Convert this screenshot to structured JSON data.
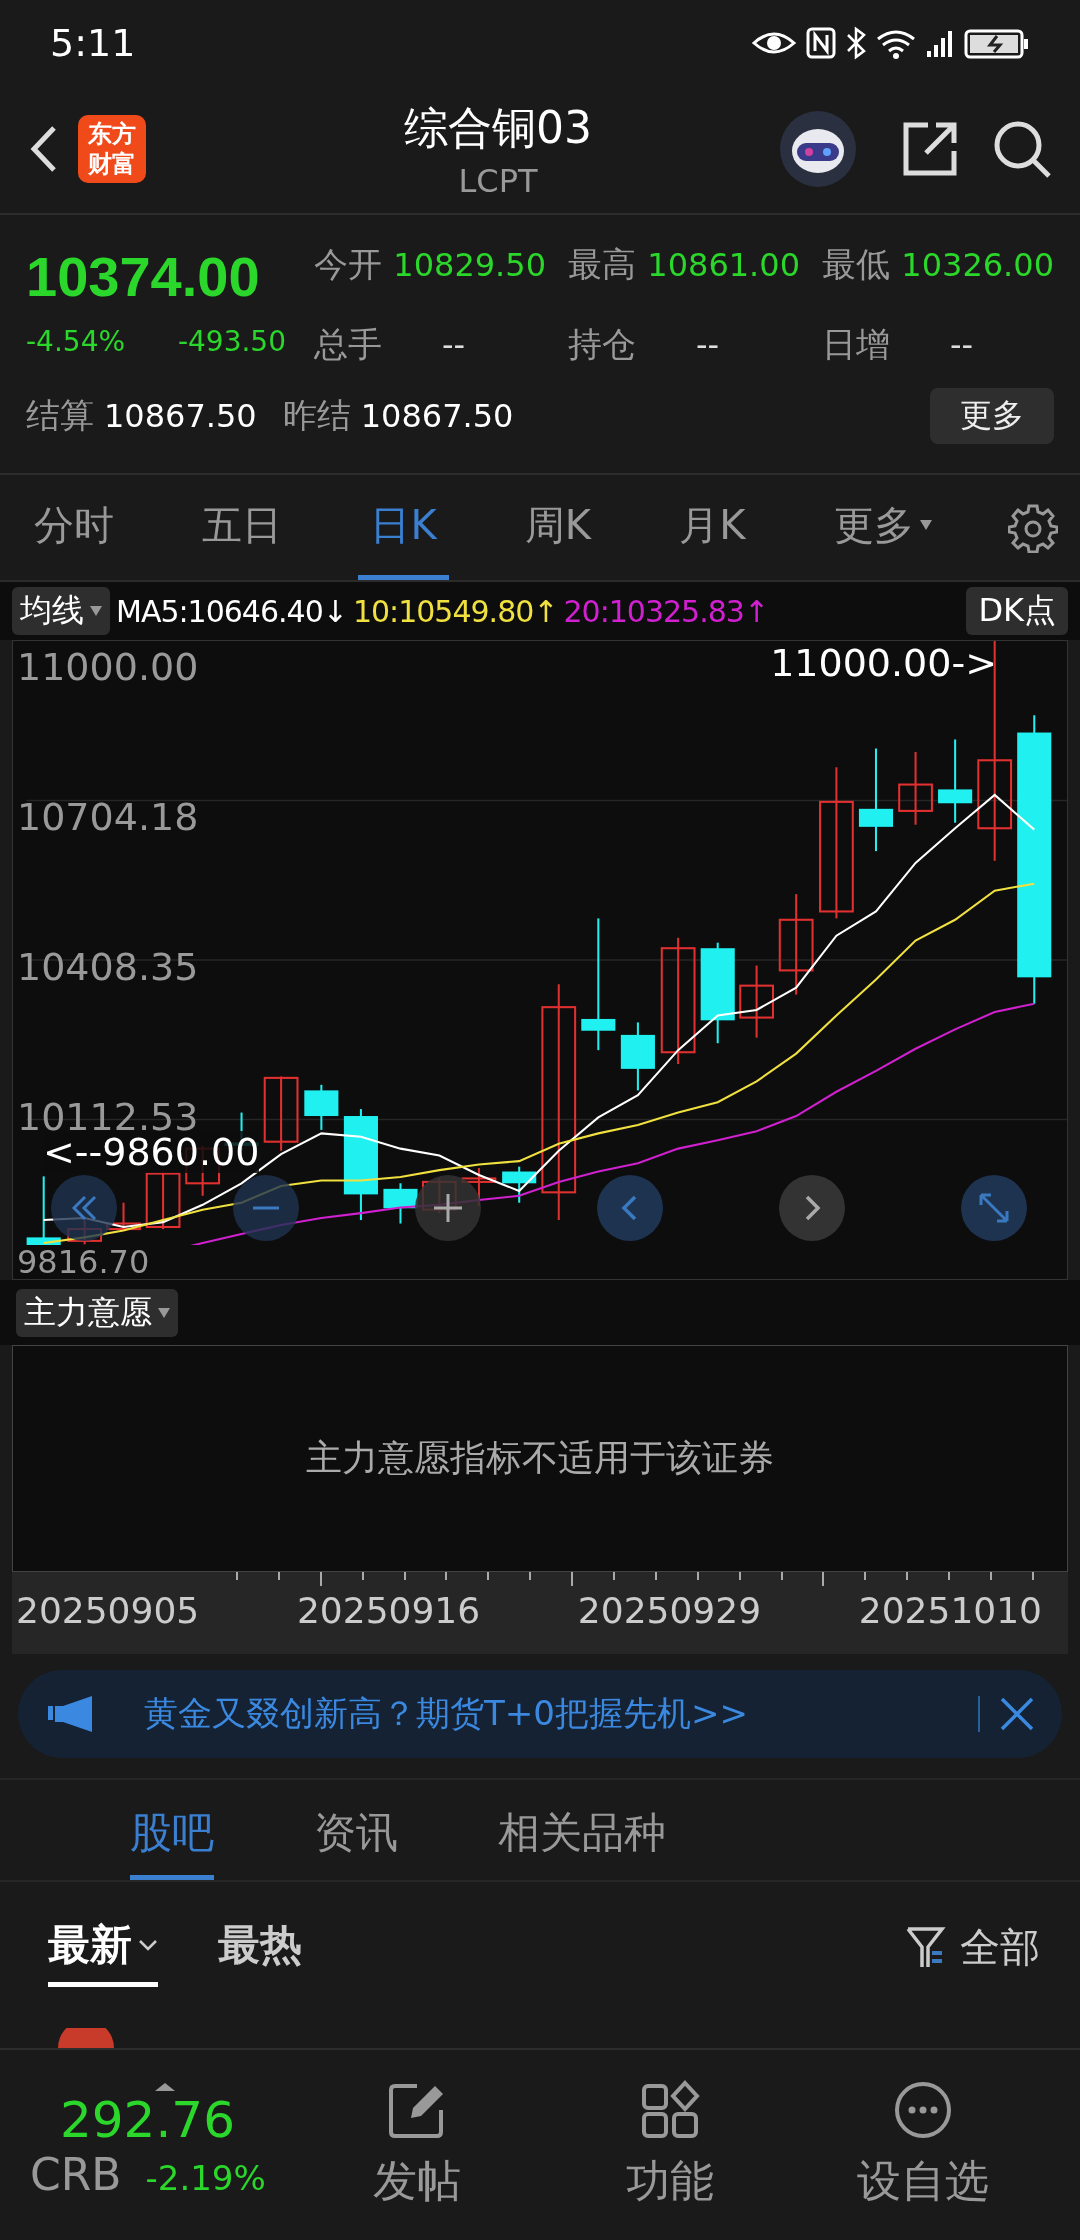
{
  "status_bar": {
    "time": "5:11"
  },
  "header": {
    "title": "综合铜03",
    "subtitle": "LCPT",
    "logo": "东方财富"
  },
  "quote": {
    "price": "10374.00",
    "change_pct": "-4.54%",
    "change": "-493.50",
    "fields": [
      {
        "label": "今开",
        "value": "10829.50",
        "kind": "down"
      },
      {
        "label": "最高",
        "value": "10861.00",
        "kind": "down"
      },
      {
        "label": "最低",
        "value": "10326.00",
        "kind": "down"
      },
      {
        "label": "总手",
        "value": "--",
        "kind": "plain"
      },
      {
        "label": "持仓",
        "value": "--",
        "kind": "plain"
      },
      {
        "label": "日增",
        "value": "--",
        "kind": "plain"
      }
    ],
    "settle": [
      {
        "label": "结算",
        "value": "10867.50"
      },
      {
        "label": "昨结",
        "value": "10867.50"
      }
    ],
    "more_button": "更多"
  },
  "period_tabs": [
    {
      "label": "分时",
      "selected": false
    },
    {
      "label": "五日",
      "selected": false
    },
    {
      "label": "日K",
      "selected": true
    },
    {
      "label": "周K",
      "selected": false
    },
    {
      "label": "月K",
      "selected": false
    },
    {
      "label": "更多",
      "selected": false,
      "kind": "dropdown"
    }
  ],
  "indicators": {
    "selector": "均线",
    "ma": [
      {
        "text": "MA5:10646.40↓",
        "color": "#ffffff"
      },
      {
        "text": "10:10549.80↑",
        "color": "#f0e040"
      },
      {
        "text": "20:10325.83↑",
        "color": "#d020d0"
      }
    ],
    "dk_button": "DK点"
  },
  "chart": {
    "y_labels": [
      "11000.00",
      "10704.18",
      "10408.35",
      "10112.53",
      "9816.70"
    ],
    "high_marker": "11000.00->",
    "low_marker": "<--9860.00"
  },
  "sub_indicator": {
    "selector": "主力意愿",
    "message": "主力意愿指标不适用于该证券"
  },
  "date_axis": [
    "20250905",
    "20250916",
    "20250929",
    "20251010"
  ],
  "banner": {
    "text": "黄金又叕创新高？期货T+0把握先机>>"
  },
  "community_tabs": [
    {
      "label": "股吧",
      "selected": true
    },
    {
      "label": "资讯",
      "selected": false
    },
    {
      "label": "相关品种",
      "selected": false
    }
  ],
  "sort_tabs": [
    {
      "label": "最新",
      "selected": true
    },
    {
      "label": "最热",
      "selected": false
    }
  ],
  "filter": "全部",
  "bottom_bar": {
    "index": {
      "value": "292.76",
      "name": "CRB",
      "change": "-2.19%"
    },
    "actions": [
      {
        "label": "发帖",
        "kind": "post"
      },
      {
        "label": "功能",
        "kind": "apps"
      },
      {
        "label": "设自选",
        "kind": "watch"
      }
    ]
  }
}
